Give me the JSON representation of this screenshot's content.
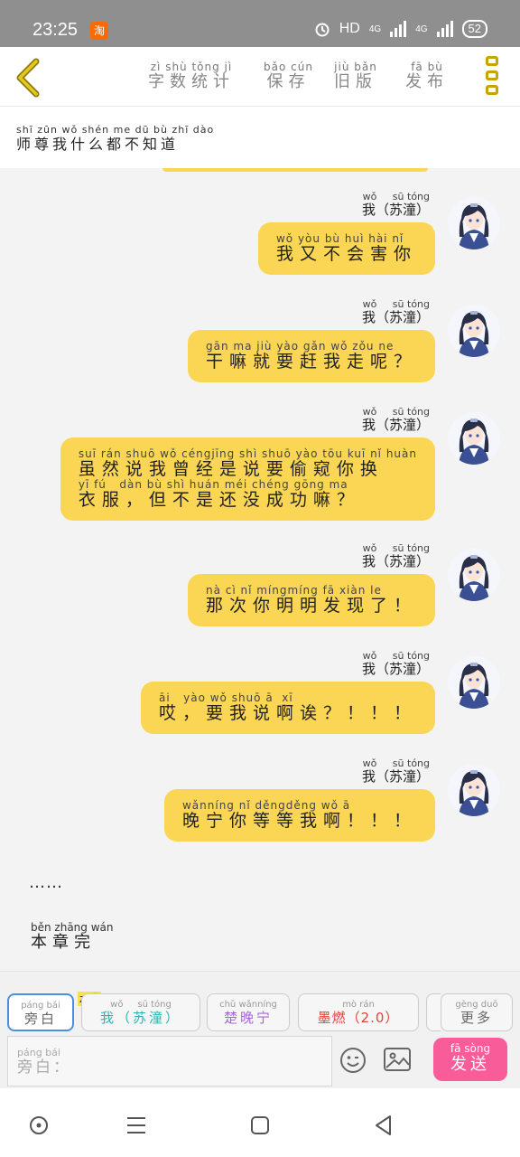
{
  "status_bar": {
    "time": "23:25",
    "taobao_glyph": "淘",
    "hd_label": "HD",
    "net1": "4G",
    "net2": "4G",
    "battery": "52"
  },
  "header": {
    "tabs": [
      {
        "pinyin": "zì shù tǒng jì",
        "label": "字数统计"
      },
      {
        "pinyin": "bǎo cún",
        "label": "保存"
      },
      {
        "pinyin": "jiù bǎn",
        "label": "旧版"
      },
      {
        "pinyin": "fā bù",
        "label": "发布"
      }
    ],
    "accent_color": "#c8a400"
  },
  "chapter": {
    "pinyin": "shī zūn wǒ shén me dū bù zhī dào",
    "title": "师尊我什么都不知道"
  },
  "messages": [
    {
      "speaker_pinyin": "wǒ     sū tóng",
      "speaker": "我（苏潼）",
      "lines": [
        {
          "pinyin": "wǒ yòu bù huì hài nǐ",
          "text": "我又不会害你"
        }
      ]
    },
    {
      "speaker_pinyin": "wǒ     sū tóng",
      "speaker": "我（苏潼）",
      "lines": [
        {
          "pinyin": "gān ma jiù yào gǎn wǒ zǒu ne",
          "text": "干嘛就要赶我走呢？"
        }
      ]
    },
    {
      "speaker_pinyin": "wǒ     sū tóng",
      "speaker": "我（苏潼）",
      "lines": [
        {
          "pinyin": "suī rán shuō wǒ céngjīng shì shuō yào tōu kuī nǐ huàn",
          "text": "虽然说我曾经是说要偷窥你换"
        },
        {
          "pinyin": "yī fú   dàn bù shì huán méi chéng gōng ma",
          "text": "衣服，但不是还没成功嘛？"
        }
      ]
    },
    {
      "speaker_pinyin": "wǒ     sū tóng",
      "speaker": "我（苏潼）",
      "lines": [
        {
          "pinyin": "nà cì nǐ míngmíng fā xiàn le",
          "text": "那次你明明发现了！"
        }
      ]
    },
    {
      "speaker_pinyin": "wǒ     sū tóng",
      "speaker": "我（苏潼）",
      "lines": [
        {
          "pinyin": "āi   yào wǒ shuō ā  xī",
          "text": "哎，要我说啊诶？！！！"
        }
      ]
    },
    {
      "speaker_pinyin": "wǒ     sū tóng",
      "speaker": "我（苏潼）",
      "lines": [
        {
          "pinyin": "wǎnníng nǐ děngděng wǒ ā",
          "text": "晚宁你等等我啊！！！"
        }
      ]
    }
  ],
  "narration": "……",
  "end": {
    "pinyin": "běn zhāng wán",
    "text": "本章完"
  },
  "roles": [
    {
      "pinyin": "páng bái",
      "label": "旁白",
      "color": "#666666"
    },
    {
      "tag_pinyin": "zhǔ",
      "pinyin": "wǒ     sū tóng",
      "label": "我（苏潼）",
      "color": "#2bb5b0"
    },
    {
      "pinyin": "chǔ wǎnníng",
      "label": "楚晚宁",
      "color": "#a56ad1"
    },
    {
      "pinyin": "mò rán",
      "label": "墨燃（2.0）",
      "color": "#e0443c"
    },
    {
      "pinyin": "gèng duō",
      "label": "更多",
      "color": "#666666"
    }
  ],
  "input": {
    "placeholder_pinyin": "páng bái",
    "placeholder": "旁白："
  },
  "send": {
    "pinyin": "fā sòng",
    "label": "发送",
    "color": "#f85d9a"
  },
  "bubble_color": "#fbd655",
  "icons": [
    "back-arrow-icon",
    "more-menu-icon",
    "alarm-icon",
    "signal-icon",
    "emoji-icon",
    "image-icon",
    "circle-nav-icon",
    "menu-nav-icon",
    "home-nav-icon",
    "back-nav-icon"
  ]
}
